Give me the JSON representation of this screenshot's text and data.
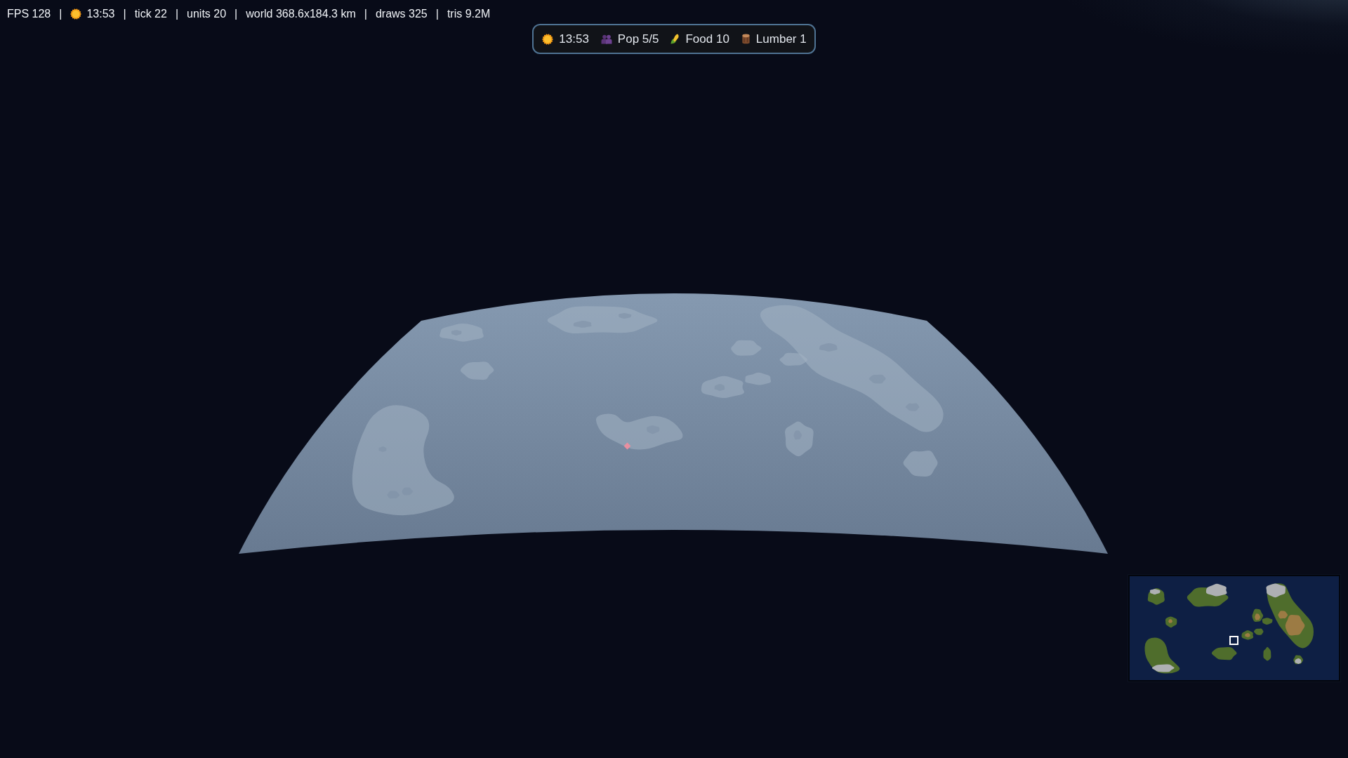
{
  "debug_bar": {
    "items": [
      {
        "kind": "stat",
        "text": "FPS 128"
      },
      {
        "kind": "separator",
        "text": "|"
      },
      {
        "kind": "clock",
        "text": "13:53"
      },
      {
        "kind": "separator",
        "text": "|"
      },
      {
        "kind": "stat",
        "text": "tick 22"
      },
      {
        "kind": "separator",
        "text": "|"
      },
      {
        "kind": "stat",
        "text": "units 20"
      },
      {
        "kind": "separator",
        "text": "|"
      },
      {
        "kind": "stat",
        "text": "world 368.6x184.3 km"
      },
      {
        "kind": "separator",
        "text": "|"
      },
      {
        "kind": "stat",
        "text": "draws 325"
      },
      {
        "kind": "separator",
        "text": "|"
      },
      {
        "kind": "stat",
        "text": "tris 9.2M"
      }
    ]
  },
  "resource_bar": {
    "items": [
      {
        "kind": "time",
        "text": "13:53"
      },
      {
        "kind": "population",
        "text": "Pop 5/5"
      },
      {
        "kind": "food",
        "text": "Food 10"
      },
      {
        "kind": "lumber",
        "text": "Lumber 1"
      }
    ]
  }
}
